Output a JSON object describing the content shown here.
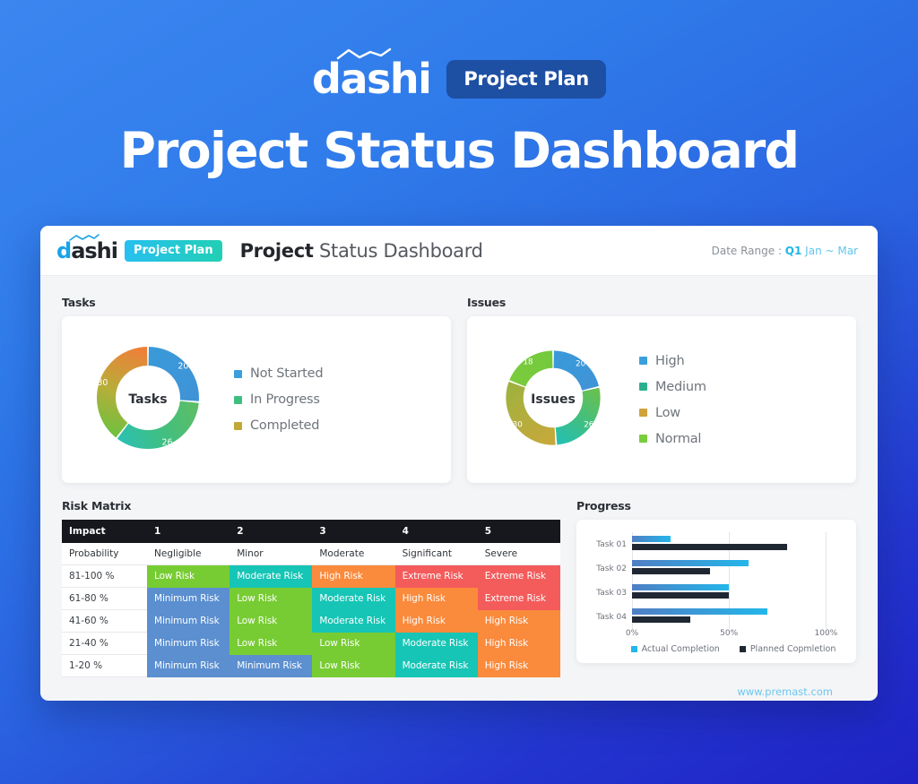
{
  "hero": {
    "logo_text": "dashi",
    "badge": "Project Plan",
    "title": "Project Status Dashboard"
  },
  "window_header": {
    "logo_d": "d",
    "logo_rest": "ashi",
    "badge": "Project Plan",
    "title_bold": "Project",
    "title_rest": " Status Dashboard",
    "date_label": "Date Range : ",
    "date_quarter": "Q1",
    "date_range": " Jan ~ Mar"
  },
  "sections": {
    "tasks": "Tasks",
    "issues": "Issues",
    "risk_matrix": "Risk Matrix",
    "progress": "Progress"
  },
  "footer": {
    "url": "www.premast.com"
  },
  "chart_data": [
    {
      "type": "pie",
      "title": "Tasks",
      "center_label": "Tasks",
      "categories": [
        "Not Started",
        "In Progress",
        "Completed"
      ],
      "values": [
        20,
        26,
        30
      ],
      "colors": [
        "#3b9fdc",
        "#3fbf7f",
        "#c2a636"
      ],
      "legend_position": "right"
    },
    {
      "type": "pie",
      "title": "Issues",
      "center_label": "Issues",
      "categories": [
        "High",
        "Medium",
        "Low",
        "Normal"
      ],
      "values": [
        20,
        26,
        30,
        18
      ],
      "colors": [
        "#3b9fdc",
        "#2ab08f",
        "#d0a33a",
        "#78cc3d"
      ],
      "legend_position": "right"
    },
    {
      "type": "bar",
      "title": "Progress",
      "orientation": "horizontal",
      "categories": [
        "Task 01",
        "Task 02",
        "Task 03",
        "Task 04"
      ],
      "series": [
        {
          "name": "Actual Completion",
          "values": [
            20,
            60,
            50,
            70
          ],
          "color": "#23b6ea"
        },
        {
          "name": "Planned Copmletion",
          "values": [
            80,
            40,
            50,
            30
          ],
          "color": "#1f2733"
        }
      ],
      "xlabel": "",
      "ylabel": "",
      "xlim": [
        0,
        110
      ],
      "xticks": [
        0,
        50,
        100
      ],
      "xtick_labels": [
        "0%",
        "50%",
        "100%"
      ],
      "grid": true,
      "legend_position": "bottom"
    },
    {
      "type": "table",
      "title": "Risk Matrix",
      "header": [
        "Impact",
        "1",
        "2",
        "3",
        "4",
        "5"
      ],
      "subheader": [
        "Probability",
        "Negligible",
        "Minor",
        "Moderate",
        "Significant",
        "Severe"
      ],
      "row_labels": [
        "81-100 %",
        "61-80 %",
        "41-60 %",
        "21-40 %",
        "1-20 %"
      ],
      "legend_colors": {
        "Minimum Risk": "#5b8fd0",
        "Low Risk": "#77cc33",
        "Moderate Risk": "#16c5b5",
        "High Risk": "#fa8a3c",
        "Extreme Risk": "#f45b5b"
      },
      "cells": [
        [
          {
            "label": "Low Risk",
            "color": "#77cc33"
          },
          {
            "label": "Moderate Risk",
            "color": "#16c5b5"
          },
          {
            "label": "High Risk",
            "color": "#fa8a3c"
          },
          {
            "label": "Extreme Risk",
            "color": "#f45b5b"
          },
          {
            "label": "Extreme Risk",
            "color": "#f45b5b"
          }
        ],
        [
          {
            "label": "Minimum Risk",
            "color": "#5b8fd0"
          },
          {
            "label": "Low Risk",
            "color": "#77cc33"
          },
          {
            "label": "Moderate Risk",
            "color": "#16c5b5"
          },
          {
            "label": "High Risk",
            "color": "#fa8a3c"
          },
          {
            "label": "Extreme Risk",
            "color": "#f45b5b"
          }
        ],
        [
          {
            "label": "Minimum Risk",
            "color": "#5b8fd0"
          },
          {
            "label": "Low Risk",
            "color": "#77cc33"
          },
          {
            "label": "Moderate Risk",
            "color": "#16c5b5"
          },
          {
            "label": "High Risk",
            "color": "#fa8a3c"
          },
          {
            "label": "High Risk",
            "color": "#fa8a3c"
          }
        ],
        [
          {
            "label": "Minimum Risk",
            "color": "#5b8fd0"
          },
          {
            "label": "Low Risk",
            "color": "#77cc33"
          },
          {
            "label": "Low Risk",
            "color": "#77cc33"
          },
          {
            "label": "Moderate Risk",
            "color": "#16c5b5"
          },
          {
            "label": "High Risk",
            "color": "#fa8a3c"
          }
        ],
        [
          {
            "label": "Minimum Risk",
            "color": "#5b8fd0"
          },
          {
            "label": "Minimum Risk",
            "color": "#5b8fd0"
          },
          {
            "label": "Low Risk",
            "color": "#77cc33"
          },
          {
            "label": "Moderate Risk",
            "color": "#16c5b5"
          },
          {
            "label": "High Risk",
            "color": "#fa8a3c"
          }
        ]
      ]
    }
  ]
}
